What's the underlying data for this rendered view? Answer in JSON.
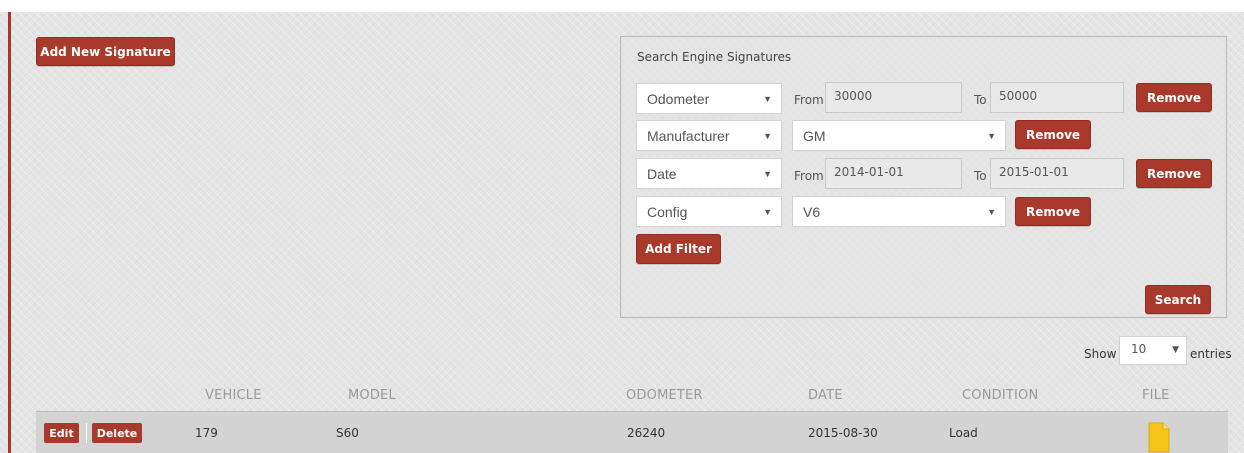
{
  "toolbar": {
    "add_signature_label": "Add New Signature"
  },
  "search_panel": {
    "title": "Search Engine Signatures",
    "filters": [
      {
        "field": "Odometer",
        "type": "range",
        "from_label": "From",
        "from_value": "30000",
        "to_label": "To",
        "to_value": "50000",
        "remove_label": "Remove"
      },
      {
        "field": "Manufacturer",
        "type": "select",
        "value": "GM",
        "remove_label": "Remove"
      },
      {
        "field": "Date",
        "type": "range",
        "from_label": "From",
        "from_value": "2014-01-01",
        "to_label": "To",
        "to_value": "2015-01-01",
        "remove_label": "Remove"
      },
      {
        "field": "Config",
        "type": "select",
        "value": "V6",
        "remove_label": "Remove"
      }
    ],
    "add_filter_label": "Add Filter",
    "search_label": "Search"
  },
  "table": {
    "show_label": "Show",
    "page_size": "10",
    "entries_label": "entries",
    "columns": [
      "VEHICLE",
      "MODEL",
      "ODOMETER",
      "DATE",
      "CONDITION",
      "FILE"
    ],
    "rows": [
      {
        "edit_label": "Edit",
        "delete_label": "Delete",
        "vehicle": "179",
        "model": "S60",
        "odometer": "26240",
        "date": "2015-08-30",
        "condition": "Load",
        "file_icon": "file-icon"
      }
    ]
  },
  "colors": {
    "accent": "#a8392b",
    "background": "#e4e4e4",
    "row_highlight": "#d3d3d3",
    "file_icon": "#f5c518"
  }
}
